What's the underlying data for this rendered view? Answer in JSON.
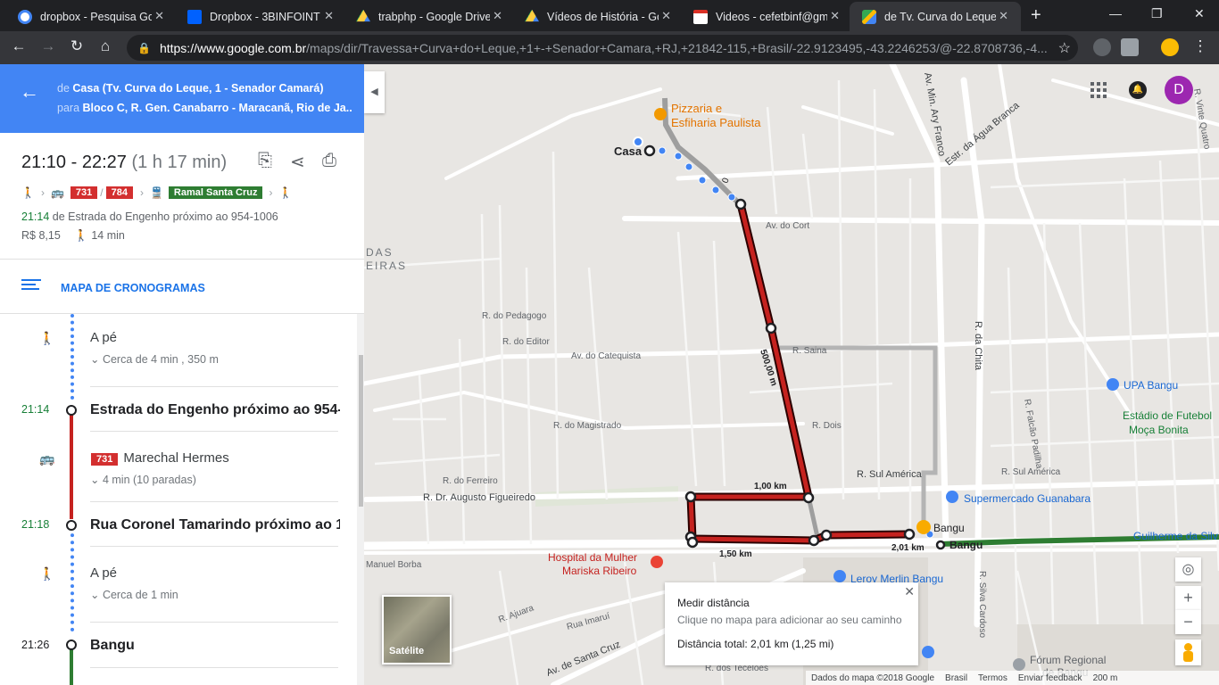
{
  "browser": {
    "tabs": [
      {
        "title": "dropbox - Pesquisa Goo",
        "icon": "google-icon"
      },
      {
        "title": "Dropbox - 3BINFOINT -",
        "icon": "dropbox-icon"
      },
      {
        "title": "trabphp - Google Drive",
        "icon": "drive-icon"
      },
      {
        "title": "Vídeos de História - Go",
        "icon": "drive-icon"
      },
      {
        "title": "Videos - cefetbinf@gm",
        "icon": "gmail-icon"
      },
      {
        "title": "de Tv. Curva do Leque,",
        "icon": "maps-icon"
      }
    ],
    "url_host": "https://www.google.com.br",
    "url_path": "/maps/dir/Travessa+Curva+do+Leque,+1+-+Senador+Camara,+RJ,+21842-115,+Brasil/-22.9123495,-43.2246253/@-22.8708736,-4..."
  },
  "directions": {
    "from_prefix": "de",
    "from": "Casa (Tv. Curva do Leque, 1 - Senador Camará)",
    "to_prefix": "para",
    "to": "Bloco C, R. Gen. Canabarro - Maracanã, Rio de Ja..."
  },
  "summary": {
    "time_range": "21:10 - 22:27",
    "duration": "(1 h 17 min)",
    "bus1": "731",
    "bus2": "784",
    "train": "Ramal Santa Cruz",
    "depart_time": "21:14",
    "depart_text": "de Estrada do Engenho próximo ao 954-1006",
    "fare": "R$ 8,15",
    "walk": "14 min"
  },
  "schedule_label": "MAPA DE CRONOGRAMAS",
  "steps": {
    "walk1_title": "A pé",
    "walk1_sub": "Cerca de 4 min , 350 m",
    "stop1_time": "21:14",
    "stop1_name": "Estrada do Engenho próximo ao 954-...",
    "bus_badge": "731",
    "bus_dest": "Marechal Hermes",
    "bus_sub": "4 min (10 paradas)",
    "stop2_time": "21:18",
    "stop2_name": "Rua Coronel Tamarindo próximo ao 1...",
    "walk2_title": "A pé",
    "walk2_sub": "Cerca de 1 min",
    "stop3_time": "21:26",
    "stop3_name": "Bangu"
  },
  "map": {
    "avatar_letter": "D",
    "satellite": "Satélite",
    "measure_title": "Medir distância",
    "measure_hint": "Clique no mapa para adicionar ao seu caminho",
    "measure_total": "Distância total: 2,01 km (1,25 mi)",
    "footer": [
      "Dados do mapa ©2018 Google",
      "Brasil",
      "Termos",
      "Enviar feedback",
      "200 m"
    ],
    "labels": {
      "casa": "Casa",
      "pizzaria1": "Pizzaria e",
      "pizzaria2": "Esfiharia Paulista",
      "bangu": "Bangu",
      "bangu_station": "Bangu",
      "hospital1": "Hospital da Mulher",
      "hospital2": "Mariska Ribeiro",
      "supermercado": "Supermercado Guanabara",
      "upa": "UPA Bangu",
      "estadio1": "Estádio de Futebol",
      "estadio2": "Moça Bonita",
      "leroy": "Leroy Merlin Bangu",
      "forum1": "Fórum Regional",
      "forum2": "de Bangu",
      "guilherme": "Guilherme da Silv",
      "das": "DAS",
      "eiras": "EIRAS",
      "dist_500": "500,00 m",
      "dist_100": "1,00 km",
      "dist_150": "1,50 km",
      "dist_201": "2,01 km",
      "dist_0": "0",
      "rua_sul_america": "R. Sul América",
      "rua_augusto": "R. Dr. Augusto Figueiredo",
      "av_cort": "Av. do Cort",
      "estr_agua_branca": "Estr. da Água Branca",
      "av_catequista": "Av. do Catequista",
      "r_magistrado": "R. do Magistrado",
      "r_pedagogo": "R. do Pedagogo",
      "r_editor": "R. do Editor",
      "r_saina": "R. Saina",
      "r_dois": "R. Dois",
      "r_da_chita": "R. da Chita",
      "r_ferreiro": "R. do Ferreiro",
      "av_santa_cruz": "Av. de Santa Cruz",
      "r_silva_cardoso": "R. Silva Cardoso",
      "manuel_borba": "Manuel Borba",
      "r_ajuara": "R. Ajuara",
      "rua_imarui": "Rua Imaruí",
      "r_tecelos": "R. dos Tecelões",
      "av_min_ary_franco": "Av. Min. Ary Franco",
      "r_falcao_padilha": "R. Falcão Padilha",
      "r_vinte_quatro": "R. Vinte Quatro"
    }
  }
}
